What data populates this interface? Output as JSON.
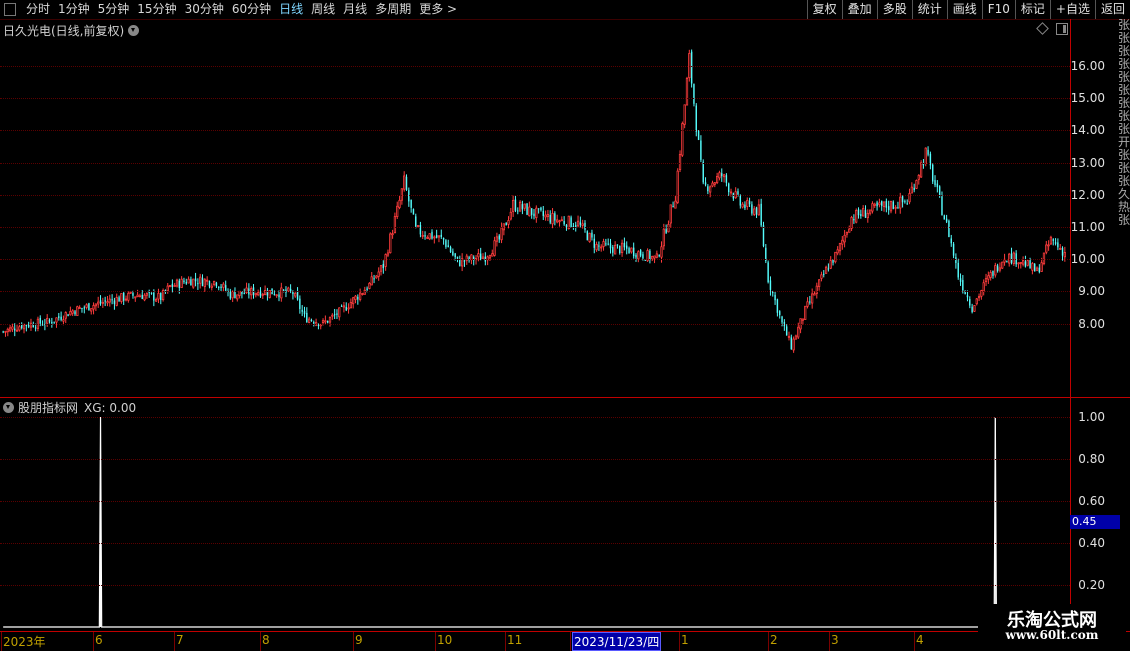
{
  "toolbar": {
    "periods": [
      "分时",
      "1分钟",
      "5分钟",
      "15分钟",
      "30分钟",
      "60分钟",
      "日线",
      "周线",
      "月线",
      "多周期",
      "更多 >"
    ],
    "active_period": "日线",
    "right_buttons": [
      "复权",
      "叠加",
      "多股",
      "统计",
      "画线",
      "F10",
      "标记",
      "+自选",
      "返回"
    ]
  },
  "main_chart": {
    "title": "日久光电(日线,前复权)",
    "price_labels": [
      "16.00",
      "15.00",
      "14.00",
      "13.00",
      "12.00",
      "11.00",
      "10.00",
      "9.00",
      "8.00"
    ]
  },
  "indicator": {
    "title": "股朋指标网",
    "xg_label": "XG: 0.00",
    "axis_labels": [
      "1.00",
      "0.80",
      "0.60",
      "0.40",
      "0.20"
    ],
    "current_value": "0.45"
  },
  "side_strip_text": "张张张张张张张张张开张张张久热张",
  "date_axis": {
    "labels": [
      "2023年",
      "6",
      "7",
      "8",
      "9",
      "10",
      "11",
      "2023/11/23/四",
      "1",
      "2",
      "3",
      "4"
    ],
    "selected": "2023/11/23/四"
  },
  "watermark": {
    "line1": "乐淘公式网",
    "line2": "www.60lt.com"
  },
  "colors": {
    "up": "#ff3c3c",
    "down": "#54fcfc",
    "axis": "#c00000",
    "grid": "#5a0000",
    "indicator": "#ffffff"
  },
  "chart_data": {
    "type": "candlestick",
    "ylim_price": [
      7.0,
      17.0
    ],
    "anchors": [
      [
        0,
        7.75
      ],
      [
        8,
        7.95
      ],
      [
        20,
        8.05
      ],
      [
        30,
        8.4
      ],
      [
        45,
        8.7
      ],
      [
        58,
        8.9
      ],
      [
        68,
        8.8
      ],
      [
        72,
        9.15
      ],
      [
        80,
        9.35
      ],
      [
        92,
        9.3
      ],
      [
        98,
        8.9
      ],
      [
        110,
        9.0
      ],
      [
        125,
        8.95
      ],
      [
        130,
        8.2
      ],
      [
        138,
        8.0
      ],
      [
        146,
        8.4
      ],
      [
        152,
        8.8
      ],
      [
        158,
        9.2
      ],
      [
        164,
        9.8
      ],
      [
        170,
        11.5
      ],
      [
        173,
        12.4
      ],
      [
        178,
        10.9
      ],
      [
        190,
        10.6
      ],
      [
        196,
        9.9
      ],
      [
        208,
        10.1
      ],
      [
        214,
        10.6
      ],
      [
        220,
        11.7
      ],
      [
        230,
        11.4
      ],
      [
        240,
        11.2
      ],
      [
        248,
        11.1
      ],
      [
        256,
        10.4
      ],
      [
        270,
        10.3
      ],
      [
        282,
        10.0
      ],
      [
        290,
        12.0
      ],
      [
        296,
        16.2
      ],
      [
        302,
        12.2
      ],
      [
        310,
        12.6
      ],
      [
        318,
        11.7
      ],
      [
        326,
        11.5
      ],
      [
        330,
        9.4
      ],
      [
        336,
        8.0
      ],
      [
        340,
        7.3
      ],
      [
        346,
        8.4
      ],
      [
        356,
        9.8
      ],
      [
        360,
        10.2
      ],
      [
        366,
        11.3
      ],
      [
        378,
        11.6
      ],
      [
        390,
        11.8
      ],
      [
        398,
        13.3
      ],
      [
        404,
        11.8
      ],
      [
        408,
        10.8
      ],
      [
        412,
        9.5
      ],
      [
        418,
        8.5
      ],
      [
        424,
        9.3
      ],
      [
        432,
        10.1
      ],
      [
        438,
        10.0
      ],
      [
        446,
        9.6
      ],
      [
        452,
        10.6
      ],
      [
        458,
        10.2
      ]
    ],
    "xg_signal_bars": [
      42,
      428
    ],
    "xg_values": [
      1.0,
      1.0
    ]
  }
}
